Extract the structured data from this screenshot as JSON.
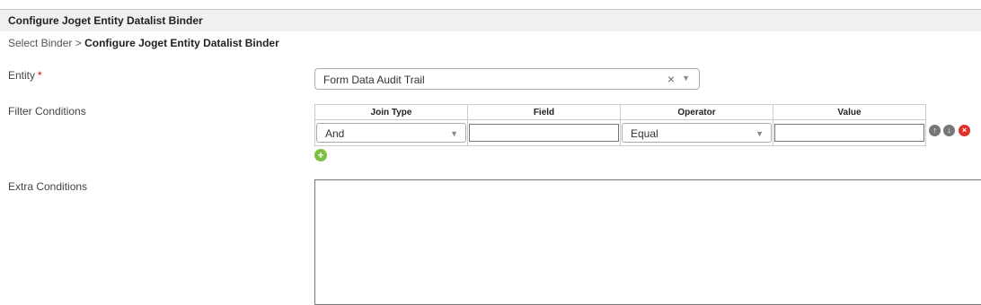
{
  "header": {
    "title": "Configure Joget Entity Datalist Binder"
  },
  "breadcrumb": {
    "parent": "Select Binder",
    "separator": ">",
    "current": "Configure Joget Entity Datalist Binder"
  },
  "entity": {
    "label": "Entity",
    "required_mark": "*",
    "value": "Form Data Audit Trail",
    "clear_glyph": "×",
    "arrow_glyph": "▼"
  },
  "filter": {
    "label": "Filter Conditions",
    "columns": [
      "Join Type",
      "Field",
      "Operator",
      "Value"
    ],
    "rows": [
      {
        "join_type": "And",
        "field": "",
        "operator": "Equal",
        "value": ""
      }
    ],
    "row_icons": [
      "move-up-icon",
      "move-down-icon",
      "delete-icon"
    ],
    "add_icon": "add-icon"
  },
  "extra": {
    "label": "Extra Conditions",
    "value": ""
  },
  "colors": {
    "title_bar_bg": "#f0f0f0",
    "required": "#dd0000",
    "add_green": "#7cc043",
    "delete_red": "#e0302a",
    "move_gray": "#777777"
  }
}
